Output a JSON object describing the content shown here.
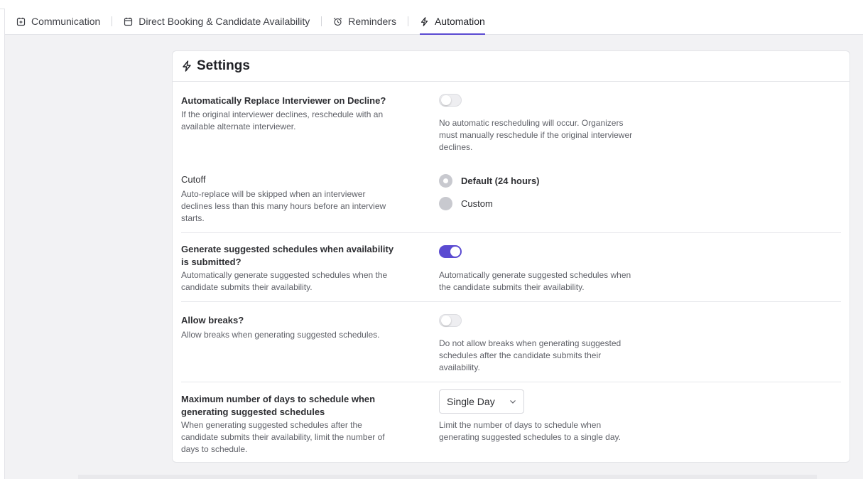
{
  "tabs": [
    {
      "label": "Communication",
      "icon": "calendar-plus-icon",
      "active": false
    },
    {
      "label": "Direct Booking & Candidate Availability",
      "icon": "calendar-icon",
      "active": false
    },
    {
      "label": "Reminders",
      "icon": "alarm-clock-icon",
      "active": false
    },
    {
      "label": "Automation",
      "icon": "lightning-icon",
      "active": true
    }
  ],
  "settings": {
    "title": "Settings",
    "icon": "lightning-icon",
    "auto_replace": {
      "title": "Automatically Replace Interviewer on Decline?",
      "description": "If the original interviewer declines, reschedule with an available alternate interviewer.",
      "enabled": false,
      "state_description": "No automatic rescheduling will occur. Organizers must manually reschedule if the original interviewer declines."
    },
    "cutoff": {
      "title": "Cutoff",
      "description": "Auto-replace will be skipped when an interviewer declines less than this many hours before an interview starts.",
      "options": [
        {
          "label": "Default (24 hours)",
          "selected": true
        },
        {
          "label": "Custom",
          "selected": false
        }
      ]
    },
    "suggested_schedules": {
      "title": "Generate suggested schedules when availability is submitted?",
      "description": "Automatically generate suggested schedules when the candidate submits their availability.",
      "enabled": true,
      "state_description": "Automatically generate suggested schedules when the candidate submits their availability."
    },
    "allow_breaks": {
      "title": "Allow breaks?",
      "description": "Allow breaks when generating suggested schedules.",
      "enabled": false,
      "state_description": "Do not allow breaks when generating suggested schedules after the candidate submits their availability."
    },
    "max_days": {
      "title": "Maximum number of days to schedule when generating suggested schedules",
      "description": "When generating suggested schedules after the candidate submits their availability, limit the number of days to schedule.",
      "selected_value": "Single Day",
      "state_description": "Limit the number of days to schedule when generating suggested schedules to a single day."
    }
  },
  "colors": {
    "accent": "#5b4bd1",
    "background": "#f2f2f4",
    "border": "#e3e4e8"
  }
}
